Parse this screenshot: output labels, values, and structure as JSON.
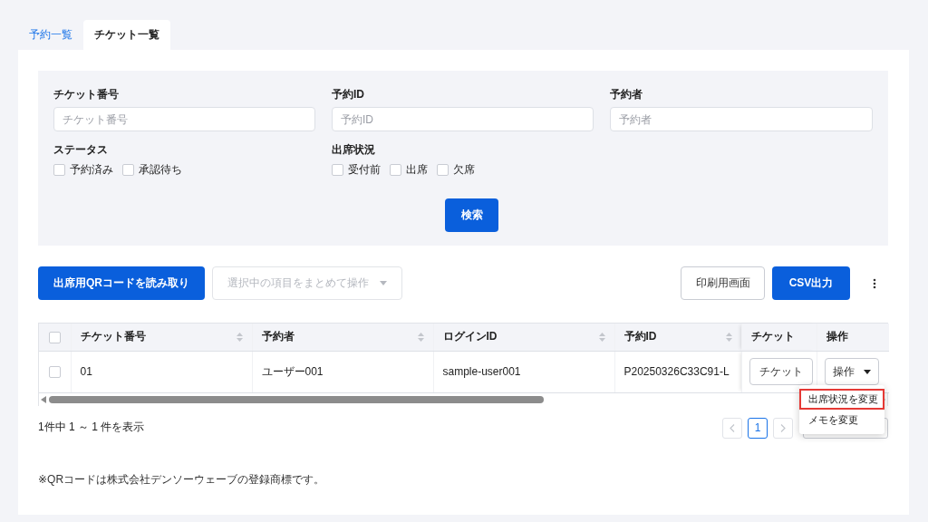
{
  "tabs": [
    {
      "label": "予約一覧",
      "selected": false
    },
    {
      "label": "チケット一覧",
      "selected": true
    }
  ],
  "filters": {
    "fields": [
      {
        "label": "チケット番号",
        "placeholder": "チケット番号"
      },
      {
        "label": "予約ID",
        "placeholder": "予約ID"
      },
      {
        "label": "予約者",
        "placeholder": "予約者"
      }
    ],
    "checkbox_groups": [
      {
        "label": "ステータス",
        "options": [
          {
            "label": "予約済み",
            "checked": false
          },
          {
            "label": "承認待ち",
            "checked": false
          }
        ]
      },
      {
        "label": "出席状況",
        "options": [
          {
            "label": "受付前",
            "checked": false
          },
          {
            "label": "出席",
            "checked": false
          },
          {
            "label": "欠席",
            "checked": false
          }
        ]
      }
    ],
    "search_button": "検索"
  },
  "toolbar": {
    "qr_button": "出席用QRコードを読み取り",
    "bulk_action": {
      "label": "選択中の項目をまとめて操作",
      "disabled": true
    },
    "print_button": "印刷用画面",
    "csv_button": "CSV出力"
  },
  "table": {
    "select_all_checked": false,
    "columns": [
      {
        "label": "チケット番号",
        "sortable": true
      },
      {
        "label": "予約者",
        "sortable": true
      },
      {
        "label": "ログインID",
        "sortable": true
      },
      {
        "label": "予約ID",
        "sortable": true
      },
      {
        "label": "チケット",
        "sortable": false
      },
      {
        "label": "操作",
        "sortable": false
      }
    ],
    "rows": [
      {
        "checked": false,
        "cells": [
          "01",
          "ユーザー001",
          "sample-user001",
          "P20250326C33C91-L"
        ],
        "ticket_button": "チケット",
        "action_button": "操作"
      }
    ]
  },
  "summary": "1件中 1 ～ 1 件を表示",
  "pagination": {
    "pages": [
      {
        "label": "1",
        "selected": true
      }
    ]
  },
  "action_menu": {
    "items": [
      {
        "label": "出席状況を変更",
        "highlighted": true
      },
      {
        "label": "メモを変更",
        "highlighted": false
      }
    ]
  },
  "footnote": "※QRコードは株式会社デンソーウェーブの登録商標です。"
}
